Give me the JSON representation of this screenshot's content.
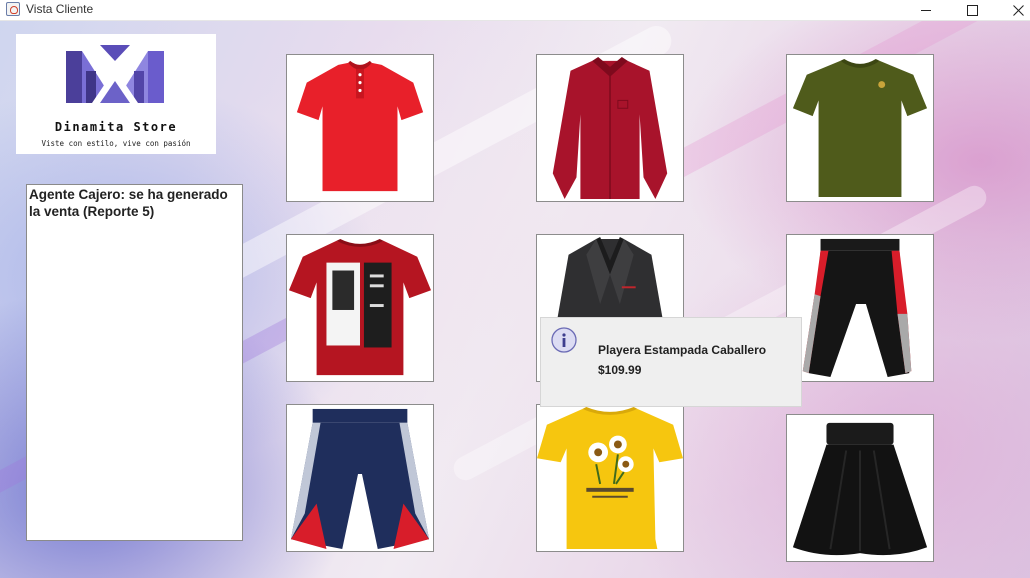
{
  "window": {
    "title": "Vista Cliente",
    "controls": [
      "minimize-icon",
      "maximize-icon",
      "close-icon"
    ]
  },
  "logo": {
    "name": "Dinamita Store",
    "tagline": "Viste con estilo, vive con pasión"
  },
  "log_area": {
    "text": "Agente Cajero: se ha generado la venta (Reporte 5)"
  },
  "products": [
    {
      "item": "red-polo-shirt"
    },
    {
      "item": "maroon-dress-shirt"
    },
    {
      "item": "olive-tshirt"
    },
    {
      "item": "red-printed-tshirt"
    },
    {
      "item": "dark-blazer"
    },
    {
      "item": "black-joggers"
    },
    {
      "item": "navy-shorts"
    },
    {
      "item": "yellow-flower-blouse"
    },
    {
      "item": "black-skirt"
    }
  ],
  "popup": {
    "icon": "info-icon",
    "product_name": "Playera Estampada Caballero",
    "price": "$109.99"
  },
  "colors": {
    "logo_purple": "#5b4fb0",
    "popup_bg": "#efefef"
  }
}
